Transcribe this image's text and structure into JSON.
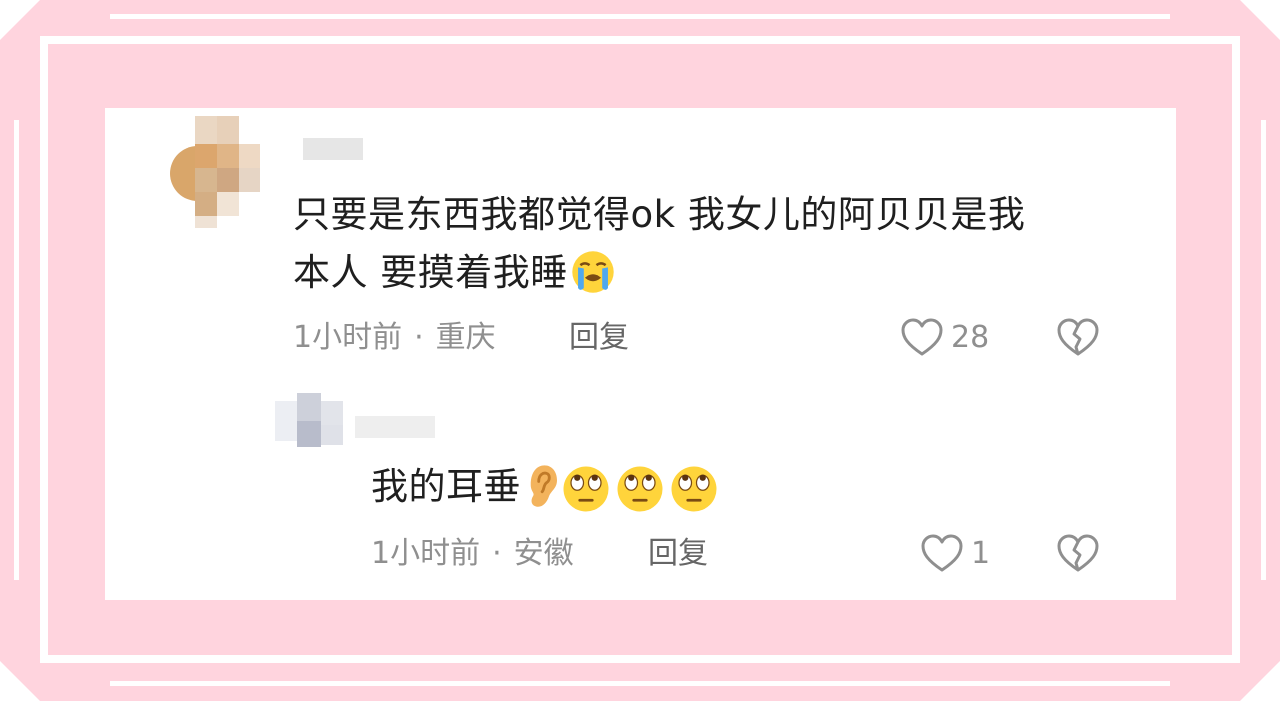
{
  "comments": [
    {
      "text_line1": "只要是东西我都觉得ok 我女儿的阿贝贝是我",
      "text_line2": "本人 要摸着我睡",
      "emoji": [
        "loudly-crying-face"
      ],
      "time": "1小时前",
      "separator": "·",
      "location": "重庆",
      "reply_label": "回复",
      "likes": "28"
    },
    {
      "text": "我的耳垂",
      "emoji": [
        "ear",
        "face-with-rolling-eyes",
        "face-with-rolling-eyes",
        "face-with-rolling-eyes"
      ],
      "time": "1小时前",
      "separator": "·",
      "location": "安徽",
      "reply_label": "回复",
      "likes": "1"
    }
  ],
  "colors": {
    "background": "#ffd4de",
    "card": "#ffffff",
    "text": "#1f1f1f",
    "meta": "#8f8f8f"
  }
}
